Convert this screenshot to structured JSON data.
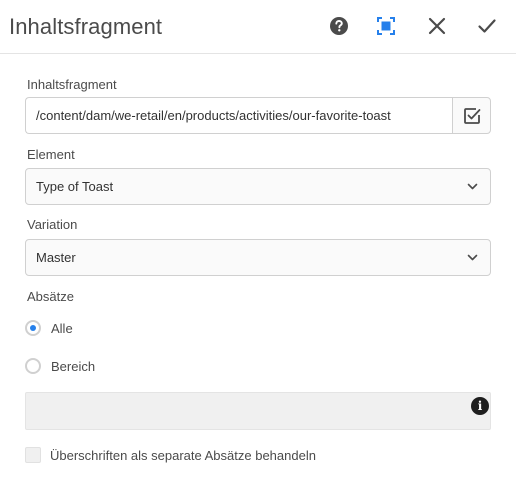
{
  "dialog": {
    "title": "Inhaltsfragment"
  },
  "form": {
    "fragment": {
      "label": "Inhaltsfragment",
      "value": "/content/dam/we-retail/en/products/activities/our-favorite-toast"
    },
    "element": {
      "label": "Element",
      "selected": "Type of Toast"
    },
    "variation": {
      "label": "Variation",
      "selected": "Master"
    },
    "paragraphs": {
      "label": "Absätze",
      "options": [
        {
          "label": "Alle",
          "checked": true
        },
        {
          "label": "Bereich",
          "checked": false
        }
      ],
      "range_value": ""
    },
    "headings_checkbox": {
      "label": "Überschriften als separate Absätze behandeln",
      "checked": false
    }
  },
  "colors": {
    "accent": "#2680eb",
    "text": "#4b4b4b"
  }
}
